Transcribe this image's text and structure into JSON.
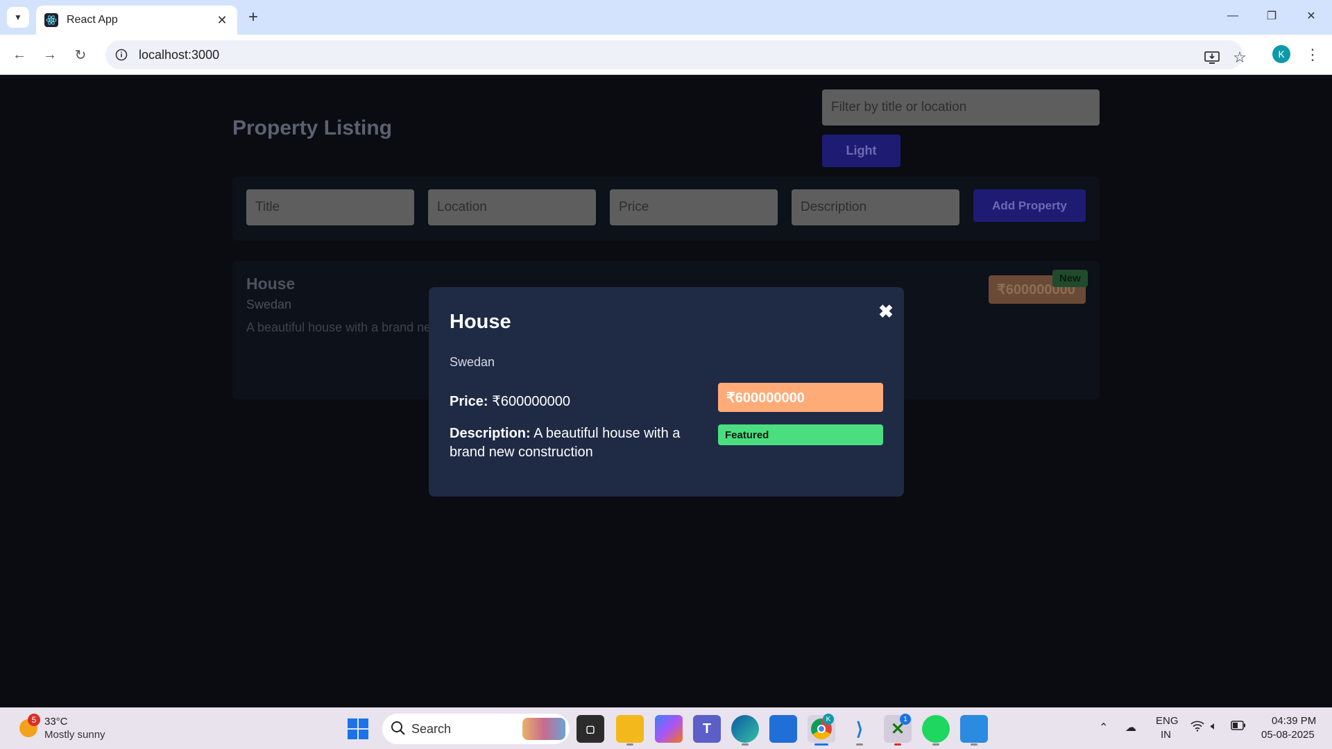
{
  "browser": {
    "tab_title": "React App",
    "url": "localhost:3000",
    "profile_initial": "K"
  },
  "app": {
    "title": "Property Listing",
    "filter_placeholder": "Filter by title or location",
    "theme_button_label": "Light",
    "form": {
      "title_placeholder": "Title",
      "location_placeholder": "Location",
      "price_placeholder": "Price",
      "description_placeholder": "Description",
      "add_button_label": "Add Property"
    },
    "listings": [
      {
        "title": "House",
        "location": "Swedan",
        "description": "A beautiful house with a brand new construction",
        "price": "₹600000000",
        "badge": "New"
      }
    ]
  },
  "modal": {
    "title": "House",
    "location": "Swedan",
    "price_label": "Price:",
    "price_value": "₹600000000",
    "description_label": "Description:",
    "description_value": "A beautiful house with a brand new construction",
    "price_badge": "₹600000000",
    "featured_label": "Featured",
    "close_symbol": "✖"
  },
  "taskbar": {
    "weather_badge": "5",
    "temperature": "33°C",
    "weather": "Mostly sunny",
    "search_label": "Search",
    "lang_line1": "ENG",
    "lang_line2": "IN",
    "time": "04:39 PM",
    "date": "05-08-2025",
    "chrome_badge": "K",
    "xbox_badge": "1"
  },
  "colors": {
    "background": "#0a0c12",
    "panel": "#0d1119",
    "modal": "#1f2a45",
    "accent_button": "#1e1b73",
    "price_badge": "#ffab78",
    "featured_badge": "#4ade80"
  }
}
